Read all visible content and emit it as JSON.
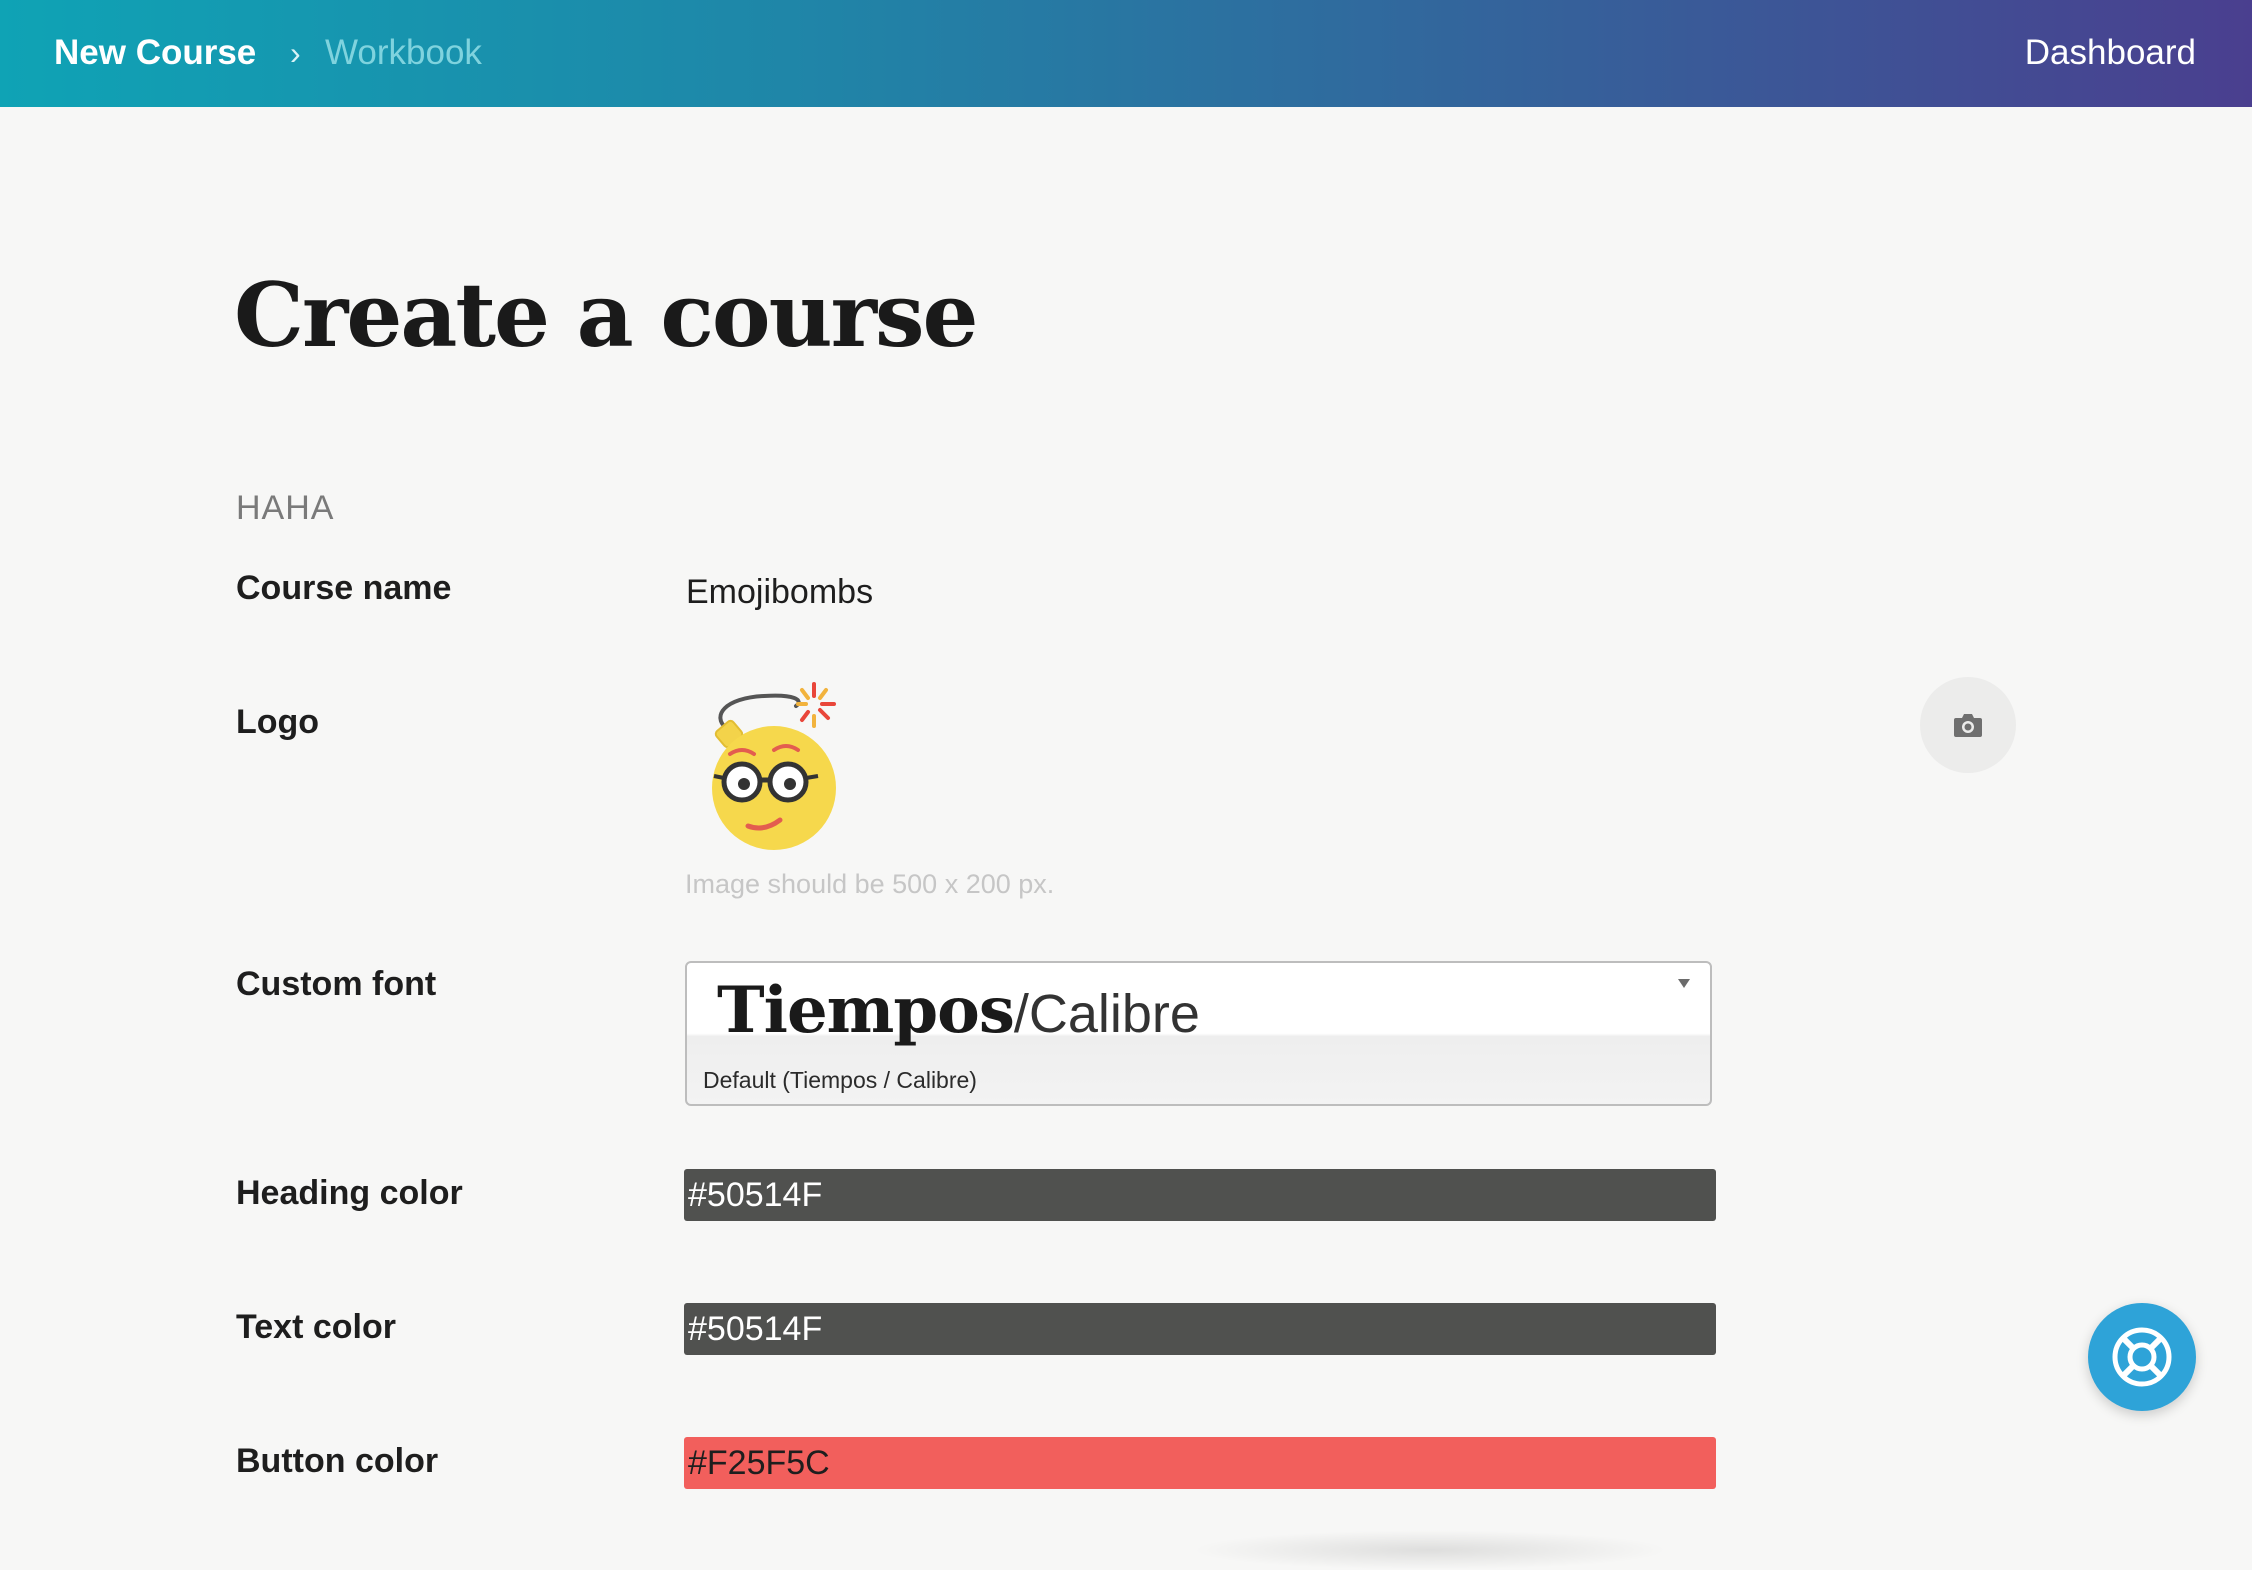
{
  "header": {
    "breadcrumb_home": "New Course",
    "breadcrumb_separator": "›",
    "breadcrumb_current": "Workbook",
    "nav_dashboard": "Dashboard",
    "gradient_start": "#0fa3b5",
    "gradient_end": "#4a3f8f"
  },
  "page": {
    "title": "Create a course",
    "section_label": "HAHA"
  },
  "form": {
    "course_name": {
      "label": "Course name",
      "value": "Emojibombs"
    },
    "logo": {
      "label": "Logo",
      "image": "emoji-bomb-nerd-icon",
      "hint": "Image should be 500 x 200 px.",
      "upload_icon": "camera-icon"
    },
    "custom_font": {
      "label": "Custom font",
      "preview_heading": "Tiempos",
      "preview_separator": "/",
      "preview_body": "Calibre",
      "selected_value": "Default (Tiempos / Calibre)"
    },
    "heading_color": {
      "label": "Heading color",
      "value": "#50514F",
      "swatch": "#50514f"
    },
    "text_color": {
      "label": "Text color",
      "value": "#50514F",
      "swatch": "#50514f"
    },
    "button_color": {
      "label": "Button color",
      "value": "#F25F5C",
      "swatch": "#f25f5c"
    }
  },
  "help": {
    "icon": "lifebuoy-icon",
    "color": "#2ea3d8"
  }
}
